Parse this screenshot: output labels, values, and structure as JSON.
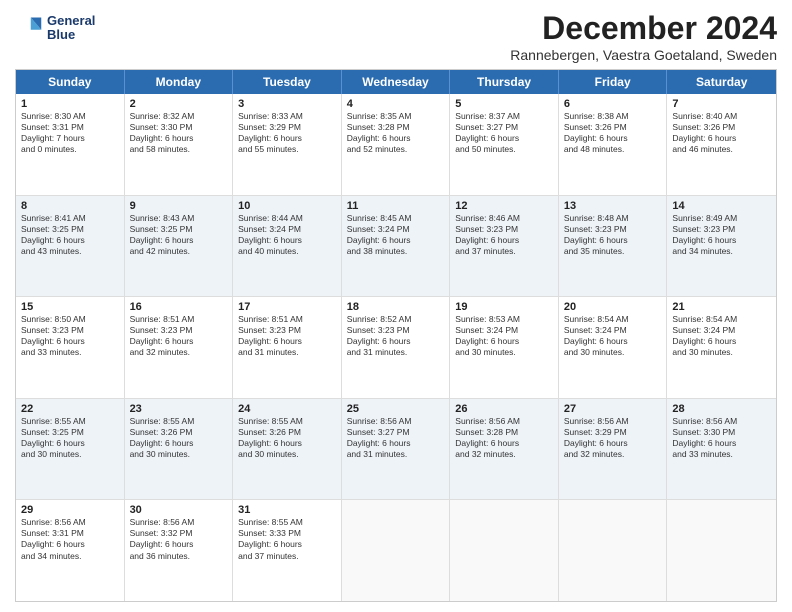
{
  "logo": {
    "line1": "General",
    "line2": "Blue"
  },
  "title": "December 2024",
  "subtitle": "Rannebergen, Vaestra Goetaland, Sweden",
  "headers": [
    "Sunday",
    "Monday",
    "Tuesday",
    "Wednesday",
    "Thursday",
    "Friday",
    "Saturday"
  ],
  "weeks": [
    {
      "alt": false,
      "cells": [
        {
          "day": "1",
          "lines": [
            "Sunrise: 8:30 AM",
            "Sunset: 3:31 PM",
            "Daylight: 7 hours",
            "and 0 minutes."
          ]
        },
        {
          "day": "2",
          "lines": [
            "Sunrise: 8:32 AM",
            "Sunset: 3:30 PM",
            "Daylight: 6 hours",
            "and 58 minutes."
          ]
        },
        {
          "day": "3",
          "lines": [
            "Sunrise: 8:33 AM",
            "Sunset: 3:29 PM",
            "Daylight: 6 hours",
            "and 55 minutes."
          ]
        },
        {
          "day": "4",
          "lines": [
            "Sunrise: 8:35 AM",
            "Sunset: 3:28 PM",
            "Daylight: 6 hours",
            "and 52 minutes."
          ]
        },
        {
          "day": "5",
          "lines": [
            "Sunrise: 8:37 AM",
            "Sunset: 3:27 PM",
            "Daylight: 6 hours",
            "and 50 minutes."
          ]
        },
        {
          "day": "6",
          "lines": [
            "Sunrise: 8:38 AM",
            "Sunset: 3:26 PM",
            "Daylight: 6 hours",
            "and 48 minutes."
          ]
        },
        {
          "day": "7",
          "lines": [
            "Sunrise: 8:40 AM",
            "Sunset: 3:26 PM",
            "Daylight: 6 hours",
            "and 46 minutes."
          ]
        }
      ]
    },
    {
      "alt": true,
      "cells": [
        {
          "day": "8",
          "lines": [
            "Sunrise: 8:41 AM",
            "Sunset: 3:25 PM",
            "Daylight: 6 hours",
            "and 43 minutes."
          ]
        },
        {
          "day": "9",
          "lines": [
            "Sunrise: 8:43 AM",
            "Sunset: 3:25 PM",
            "Daylight: 6 hours",
            "and 42 minutes."
          ]
        },
        {
          "day": "10",
          "lines": [
            "Sunrise: 8:44 AM",
            "Sunset: 3:24 PM",
            "Daylight: 6 hours",
            "and 40 minutes."
          ]
        },
        {
          "day": "11",
          "lines": [
            "Sunrise: 8:45 AM",
            "Sunset: 3:24 PM",
            "Daylight: 6 hours",
            "and 38 minutes."
          ]
        },
        {
          "day": "12",
          "lines": [
            "Sunrise: 8:46 AM",
            "Sunset: 3:23 PM",
            "Daylight: 6 hours",
            "and 37 minutes."
          ]
        },
        {
          "day": "13",
          "lines": [
            "Sunrise: 8:48 AM",
            "Sunset: 3:23 PM",
            "Daylight: 6 hours",
            "and 35 minutes."
          ]
        },
        {
          "day": "14",
          "lines": [
            "Sunrise: 8:49 AM",
            "Sunset: 3:23 PM",
            "Daylight: 6 hours",
            "and 34 minutes."
          ]
        }
      ]
    },
    {
      "alt": false,
      "cells": [
        {
          "day": "15",
          "lines": [
            "Sunrise: 8:50 AM",
            "Sunset: 3:23 PM",
            "Daylight: 6 hours",
            "and 33 minutes."
          ]
        },
        {
          "day": "16",
          "lines": [
            "Sunrise: 8:51 AM",
            "Sunset: 3:23 PM",
            "Daylight: 6 hours",
            "and 32 minutes."
          ]
        },
        {
          "day": "17",
          "lines": [
            "Sunrise: 8:51 AM",
            "Sunset: 3:23 PM",
            "Daylight: 6 hours",
            "and 31 minutes."
          ]
        },
        {
          "day": "18",
          "lines": [
            "Sunrise: 8:52 AM",
            "Sunset: 3:23 PM",
            "Daylight: 6 hours",
            "and 31 minutes."
          ]
        },
        {
          "day": "19",
          "lines": [
            "Sunrise: 8:53 AM",
            "Sunset: 3:24 PM",
            "Daylight: 6 hours",
            "and 30 minutes."
          ]
        },
        {
          "day": "20",
          "lines": [
            "Sunrise: 8:54 AM",
            "Sunset: 3:24 PM",
            "Daylight: 6 hours",
            "and 30 minutes."
          ]
        },
        {
          "day": "21",
          "lines": [
            "Sunrise: 8:54 AM",
            "Sunset: 3:24 PM",
            "Daylight: 6 hours",
            "and 30 minutes."
          ]
        }
      ]
    },
    {
      "alt": true,
      "cells": [
        {
          "day": "22",
          "lines": [
            "Sunrise: 8:55 AM",
            "Sunset: 3:25 PM",
            "Daylight: 6 hours",
            "and 30 minutes."
          ]
        },
        {
          "day": "23",
          "lines": [
            "Sunrise: 8:55 AM",
            "Sunset: 3:26 PM",
            "Daylight: 6 hours",
            "and 30 minutes."
          ]
        },
        {
          "day": "24",
          "lines": [
            "Sunrise: 8:55 AM",
            "Sunset: 3:26 PM",
            "Daylight: 6 hours",
            "and 30 minutes."
          ]
        },
        {
          "day": "25",
          "lines": [
            "Sunrise: 8:56 AM",
            "Sunset: 3:27 PM",
            "Daylight: 6 hours",
            "and 31 minutes."
          ]
        },
        {
          "day": "26",
          "lines": [
            "Sunrise: 8:56 AM",
            "Sunset: 3:28 PM",
            "Daylight: 6 hours",
            "and 32 minutes."
          ]
        },
        {
          "day": "27",
          "lines": [
            "Sunrise: 8:56 AM",
            "Sunset: 3:29 PM",
            "Daylight: 6 hours",
            "and 32 minutes."
          ]
        },
        {
          "day": "28",
          "lines": [
            "Sunrise: 8:56 AM",
            "Sunset: 3:30 PM",
            "Daylight: 6 hours",
            "and 33 minutes."
          ]
        }
      ]
    },
    {
      "alt": false,
      "cells": [
        {
          "day": "29",
          "lines": [
            "Sunrise: 8:56 AM",
            "Sunset: 3:31 PM",
            "Daylight: 6 hours",
            "and 34 minutes."
          ]
        },
        {
          "day": "30",
          "lines": [
            "Sunrise: 8:56 AM",
            "Sunset: 3:32 PM",
            "Daylight: 6 hours",
            "and 36 minutes."
          ]
        },
        {
          "day": "31",
          "lines": [
            "Sunrise: 8:55 AM",
            "Sunset: 3:33 PM",
            "Daylight: 6 hours",
            "and 37 minutes."
          ]
        },
        {
          "day": "",
          "lines": []
        },
        {
          "day": "",
          "lines": []
        },
        {
          "day": "",
          "lines": []
        },
        {
          "day": "",
          "lines": []
        }
      ]
    }
  ]
}
